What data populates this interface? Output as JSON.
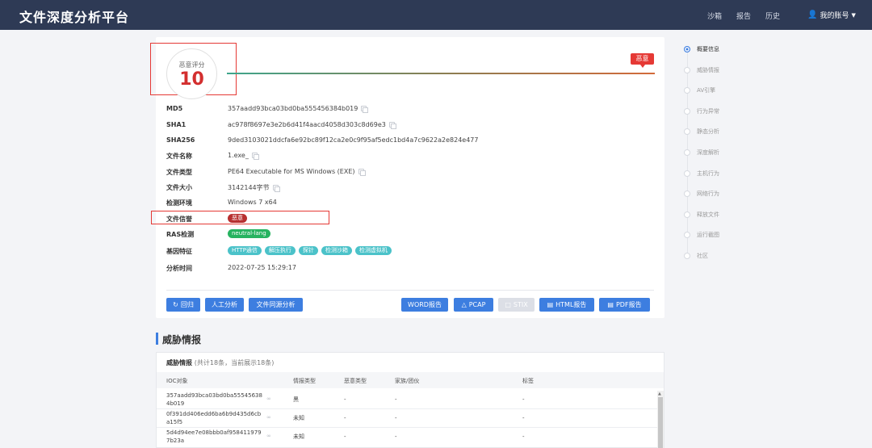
{
  "header": {
    "brand": "文件深度分析平台",
    "nav": [
      "沙箱",
      "报告",
      "历史"
    ],
    "account": "我的账号"
  },
  "score": {
    "label": "恶意评分",
    "value": "10",
    "verdict_tag": "恶意"
  },
  "details": [
    {
      "label": "MD5",
      "value": "357aadd93bca03bd0ba555456384b019",
      "copy": true
    },
    {
      "label": "SHA1",
      "value": "ac978f8697e3e2b6d41f4aacd4058d303c8d69e3",
      "copy": true
    },
    {
      "label": "SHA256",
      "value": "9ded3103021ddcfa6e92bc89f12ca2e0c9f95af5edc1bd4a7c9622a2e824e477",
      "copy": false
    },
    {
      "label": "文件名称",
      "value": "1.exe_",
      "copy": true
    },
    {
      "label": "文件类型",
      "value": "PE64 Executable for MS Windows (EXE)",
      "copy": true
    },
    {
      "label": "文件大小",
      "value": "3142144字节",
      "copy": true
    },
    {
      "label": "检测环境",
      "value": "Windows 7 x64",
      "copy": false
    }
  ],
  "reputation": {
    "label": "文件信誉",
    "badge": "恶意"
  },
  "ras": {
    "label": "RAS检测",
    "badge": "neutral-lang"
  },
  "genes": {
    "label": "基因特征",
    "tags": [
      "HTTP通信",
      "解压执行",
      "探针",
      "检测沙箱",
      "检测虚拟机"
    ]
  },
  "analysis_time": {
    "label": "分析时间",
    "value": "2022-07-25 15:29:17"
  },
  "actions": {
    "left": [
      "回归",
      "人工分析",
      "文件同源分析"
    ],
    "right": [
      "WORD报告",
      "PCAP",
      "STIX",
      "HTML报告",
      "PDF报告"
    ]
  },
  "intel": {
    "section_title": "威胁情报",
    "card_title": "威胁情报",
    "card_subtitle": "(共计18条，当前展示18条)",
    "columns": [
      "IOC对象",
      "情报类型",
      "恶意类型",
      "家族/团伙",
      "标签"
    ],
    "rows": [
      {
        "ioc": "357aadd93bca03bd0ba555456384b019",
        "type": "黑",
        "mal": "-",
        "family": "-",
        "tag": "-"
      },
      {
        "ioc": "0f391dd406edd6ba6b9d435d6cba15f5",
        "type": "未知",
        "mal": "-",
        "family": "-",
        "tag": "-"
      },
      {
        "ioc": "5d4d94ee7e08bbb0af9584119797b23a",
        "type": "未知",
        "mal": "-",
        "family": "-",
        "tag": "-"
      }
    ]
  },
  "sidenav": [
    "概要信息",
    "威胁情报",
    "AV引擎",
    "行为异常",
    "静态分析",
    "深度解析",
    "主机行为",
    "网络行为",
    "释放文件",
    "运行截图",
    "社区"
  ],
  "colors": {
    "topbar": "#2e3a55",
    "primary": "#3d7ee0",
    "danger": "#e53935",
    "success": "#27b360",
    "teal": "#4bc2c9"
  }
}
